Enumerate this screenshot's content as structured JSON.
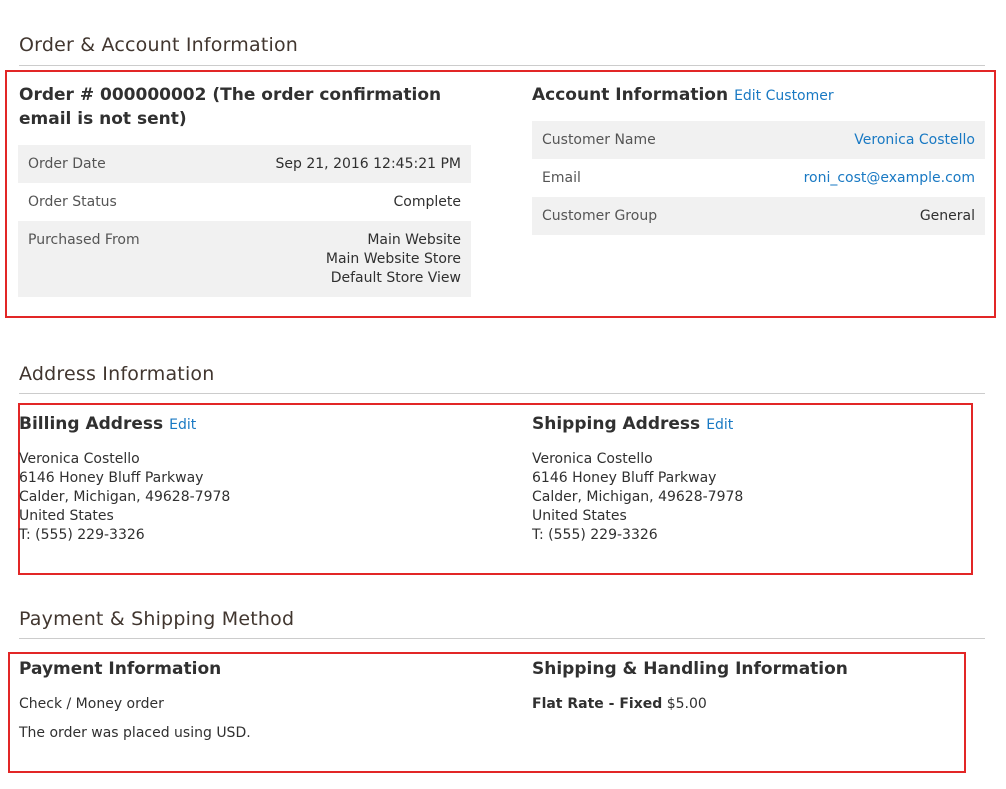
{
  "sections": {
    "order_account_title": "Order & Account Information",
    "address_title": "Address Information",
    "payment_shipping_title": "Payment & Shipping Method"
  },
  "order": {
    "heading": "Order # 000000002 (The order confirmation email is not sent)",
    "rows": [
      {
        "label": "Order Date",
        "value": "Sep 21, 2016 12:45:21 PM"
      },
      {
        "label": "Order Status",
        "value": "Complete"
      },
      {
        "label": "Purchased From",
        "value_lines": [
          "Main Website",
          "Main Website Store",
          "Default Store View"
        ]
      }
    ]
  },
  "account": {
    "heading": "Account Information",
    "edit_link": "Edit Customer",
    "rows": [
      {
        "label": "Customer Name",
        "value": "Veronica Costello"
      },
      {
        "label": "Email",
        "value": "roni_cost@example.com"
      },
      {
        "label": "Customer Group",
        "value": "General"
      }
    ]
  },
  "billing": {
    "heading": "Billing Address",
    "edit_link": "Edit",
    "lines": [
      "Veronica Costello",
      "6146 Honey Bluff Parkway",
      "Calder, Michigan, 49628-7978",
      "United States",
      "T: (555) 229-3326"
    ]
  },
  "shipping": {
    "heading": "Shipping Address",
    "edit_link": "Edit",
    "lines": [
      "Veronica Costello",
      "6146 Honey Bluff Parkway",
      "Calder, Michigan, 49628-7978",
      "United States",
      "T: (555) 229-3326"
    ]
  },
  "payment": {
    "heading": "Payment Information",
    "method": "Check / Money order",
    "currency_note": "The order was placed using USD."
  },
  "shipping_method": {
    "heading": "Shipping & Handling Information",
    "method_name": "Flat Rate - Fixed",
    "price": "$5.00"
  },
  "colors": {
    "link": "#1979c3",
    "highlight_border": "#e22626",
    "row_shade": "#f1f1f1"
  }
}
